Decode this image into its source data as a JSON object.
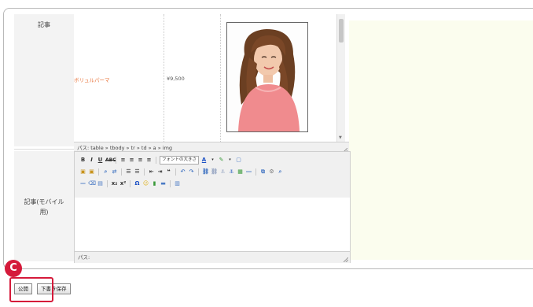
{
  "form": {
    "article_label": "記事",
    "article_mobile_label": "記事(モバイル用)"
  },
  "editor_main": {
    "product_name": "ボリュルパーマ",
    "price": "¥9,500",
    "path": "パス: table » tbody » tr » td » a » img"
  },
  "editor_mobile": {
    "font_size_select": "フォントの大きさ",
    "path": "パス:"
  },
  "actions": {
    "publish_label": "公開",
    "draft_label": "下書き保存"
  },
  "annotation": {
    "badge": "C",
    "accent_color": "#d51a3a"
  },
  "colors": {
    "label_bg": "#f3f3f3",
    "hint_bg": "#fbfdee",
    "price_text": "#e8743b"
  }
}
